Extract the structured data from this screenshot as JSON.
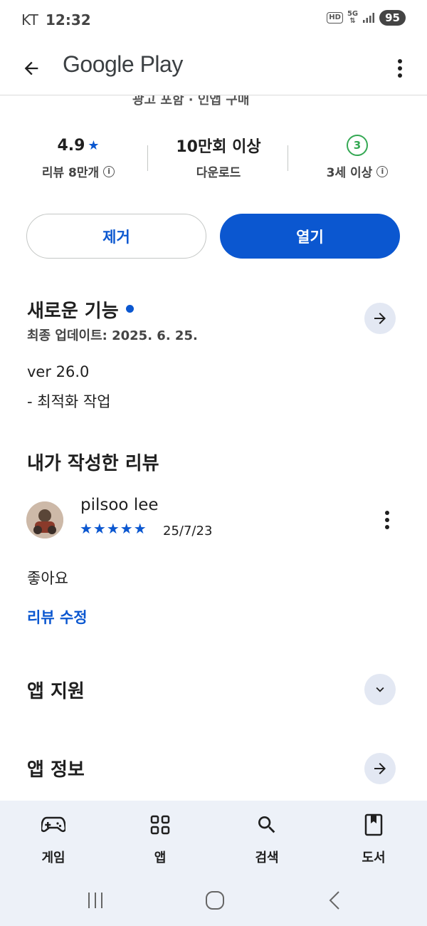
{
  "status_bar": {
    "carrier": "KT",
    "time": "12:32",
    "network": "5G",
    "battery": "95",
    "hd": "HD"
  },
  "app_bar": {
    "title": "Google Play"
  },
  "clipped_text": "광고 포함 · 인앱 구매",
  "stats": {
    "rating": {
      "value": "4.9",
      "label": "리뷰 8만개"
    },
    "downloads": {
      "value": "10만회 이상",
      "label": "다운로드"
    },
    "content_rating": {
      "badge": "3",
      "label": "3세 이상"
    }
  },
  "buttons": {
    "remove": "제거",
    "open": "열기"
  },
  "whats_new": {
    "title": "새로운 기능",
    "updated": "최종 업데이트: 2025. 6. 25.",
    "version": "ver 26.0",
    "notes": "- 최적화 작업"
  },
  "my_review": {
    "title": "내가 작성한 리뷰",
    "reviewer": "pilsoo lee",
    "stars": "★★★★★",
    "rating": 5,
    "date": "25/7/23",
    "text": "좋아요",
    "edit_link": "리뷰 수정"
  },
  "app_support": {
    "title": "앱 지원"
  },
  "app_info": {
    "title": "앱 정보"
  },
  "bottom_nav": [
    {
      "label": "게임",
      "icon": "gamepad-icon"
    },
    {
      "label": "앱",
      "icon": "apps-grid-icon"
    },
    {
      "label": "검색",
      "icon": "search-icon"
    },
    {
      "label": "도서",
      "icon": "book-icon"
    }
  ],
  "colors": {
    "accent": "#0b57d0",
    "rating_green": "#34a853",
    "nav_bg": "#edf1f8"
  }
}
